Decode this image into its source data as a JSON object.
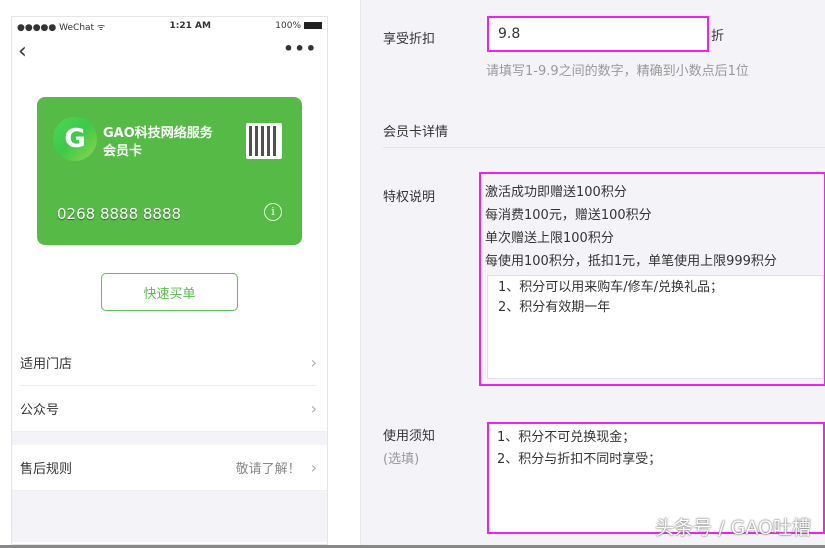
{
  "phone": {
    "status": {
      "carrier": "●●●●● WeChat ᯤ",
      "time": "1:21 AM",
      "battery": "100%"
    },
    "card": {
      "logo_letter": "G",
      "name": "GAO科技网络服务",
      "type": "会员卡",
      "number": "0268 8888 8888",
      "color": "#55bb46"
    },
    "quick_pay": "快速买单",
    "rows": [
      {
        "label": "适用门店"
      },
      {
        "label": "公众号"
      },
      {
        "label": "售后规则",
        "extra": "敬请了解！"
      }
    ]
  },
  "form": {
    "discount": {
      "label": "享受折扣",
      "value": "9.8",
      "unit": "折",
      "hint": "请填写1-9.9之间的数字，精确到小数点后1位"
    },
    "section": "会员卡详情",
    "privilege": {
      "label": "特权说明",
      "lines": [
        "激活成功即赠送100积分",
        "每消费100元，赠送100积分",
        "单次赠送上限100积分",
        "每使用100积分，抵扣1元，单笔使用上限999积分"
      ],
      "text": [
        "1、积分可以用来购车/修车/兑换礼品；",
        "2、积分有效期一年"
      ]
    },
    "notice": {
      "label": "使用须知",
      "optional": "(选填)",
      "text": [
        "1、积分不可兑换现金；",
        "2、积分与折扣不同时享受；"
      ]
    }
  },
  "watermark": "头条号 / GAO吐槽",
  "highlight_color": "#f022f0"
}
